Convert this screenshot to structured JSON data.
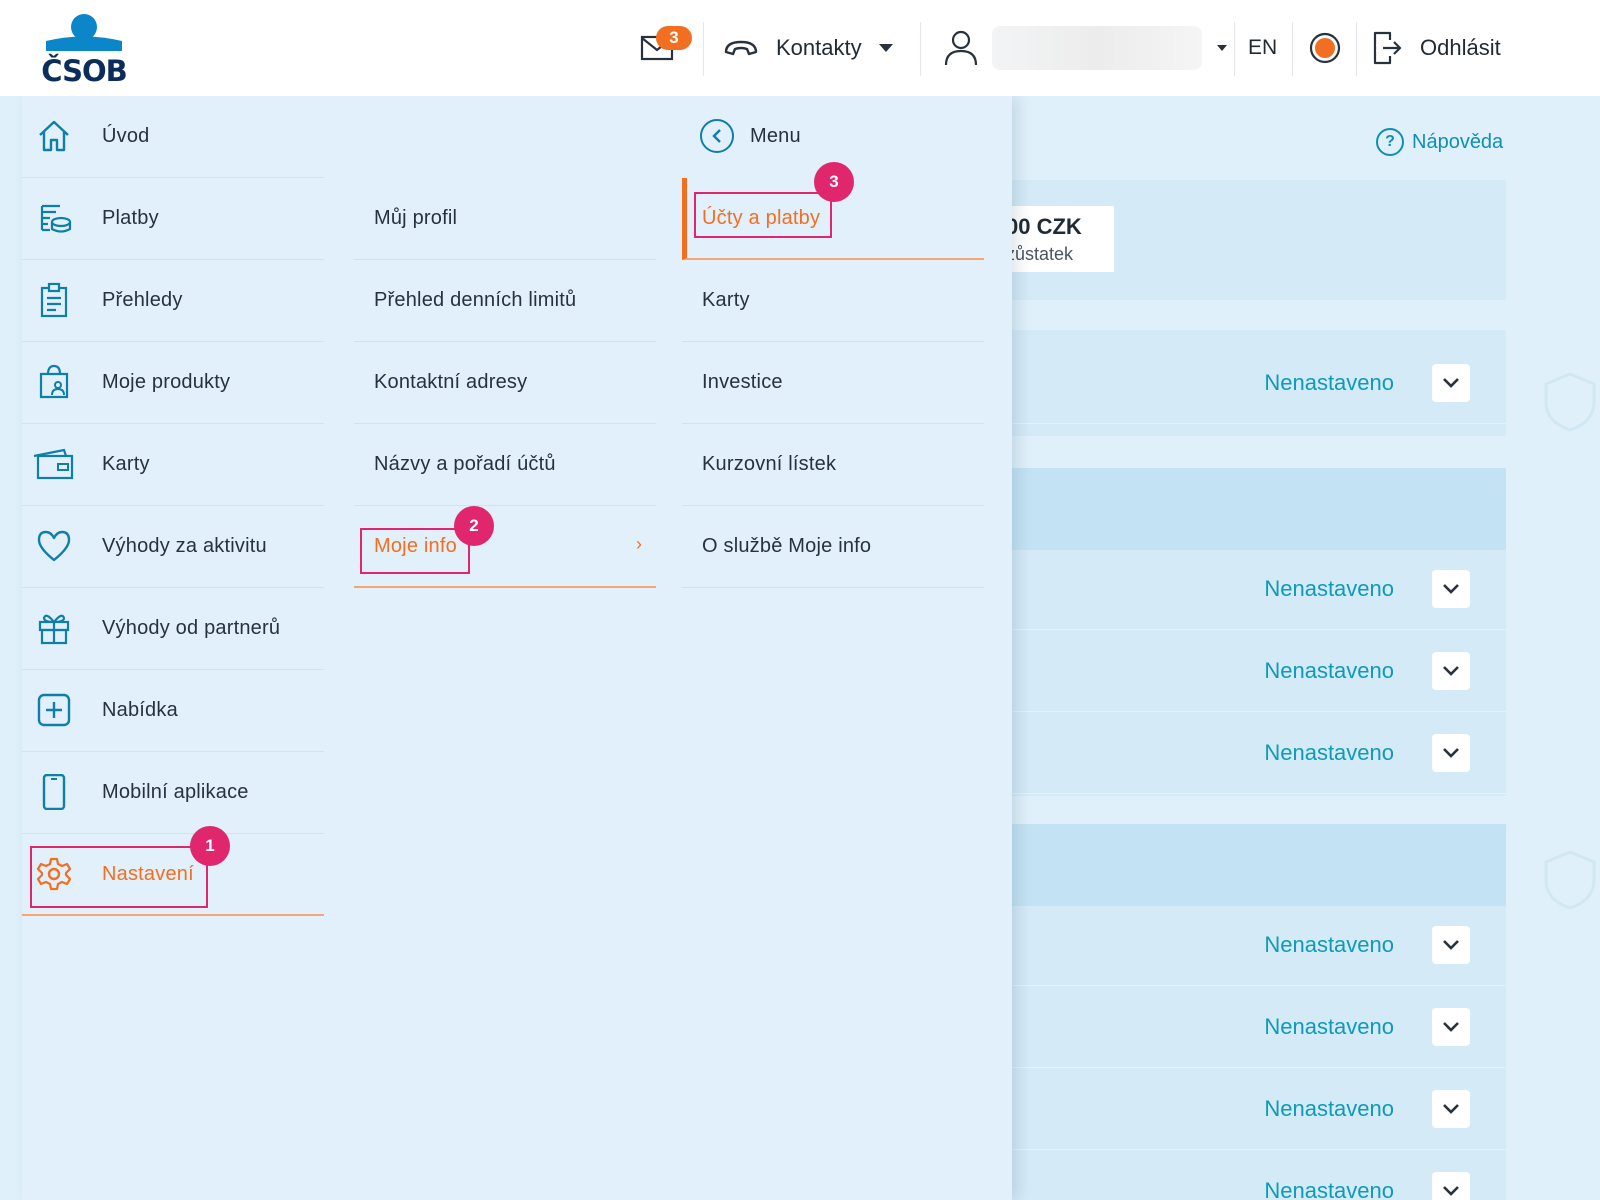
{
  "header": {
    "logo_text": "ČSOB",
    "mail_count": "3",
    "contacts_label": "Kontakty",
    "language": "EN",
    "logout_label": "Odhlásit",
    "accent_color": "#f26f21"
  },
  "background": {
    "help_label": "Nápověda",
    "balance_amount": "00 CZK",
    "balance_label": "zůstatek",
    "setting_value": "Nenastaveno"
  },
  "menu": {
    "main_items": [
      {
        "label": "Úvod",
        "icon": "home-icon"
      },
      {
        "label": "Platby",
        "icon": "coins-icon"
      },
      {
        "label": "Přehledy",
        "icon": "clipboard-icon"
      },
      {
        "label": "Moje produkty",
        "icon": "product-bag-icon"
      },
      {
        "label": "Karty",
        "icon": "card-icon"
      },
      {
        "label": "Výhody za aktivitu",
        "icon": "heart-icon"
      },
      {
        "label": "Výhody od partnerů",
        "icon": "gift-icon"
      },
      {
        "label": "Nabídka",
        "icon": "plus-square-icon"
      },
      {
        "label": "Mobilní aplikace",
        "icon": "mobile-icon"
      },
      {
        "label": "Nastavení",
        "icon": "gear-icon",
        "active": true,
        "step": "1"
      }
    ],
    "settings_items": [
      {
        "label": "Můj profil"
      },
      {
        "label": "Přehled denních limitů"
      },
      {
        "label": "Kontaktní adresy"
      },
      {
        "label": "Názvy a pořadí účtů"
      },
      {
        "label": "Moje info",
        "active": true,
        "step": "2"
      }
    ],
    "back_label": "Menu",
    "info_items": [
      {
        "label": "Účty a platby",
        "active": true,
        "step": "3"
      },
      {
        "label": "Karty"
      },
      {
        "label": "Investice"
      },
      {
        "label": "Kurzovní lístek"
      },
      {
        "label": "O službě Moje info"
      }
    ]
  }
}
